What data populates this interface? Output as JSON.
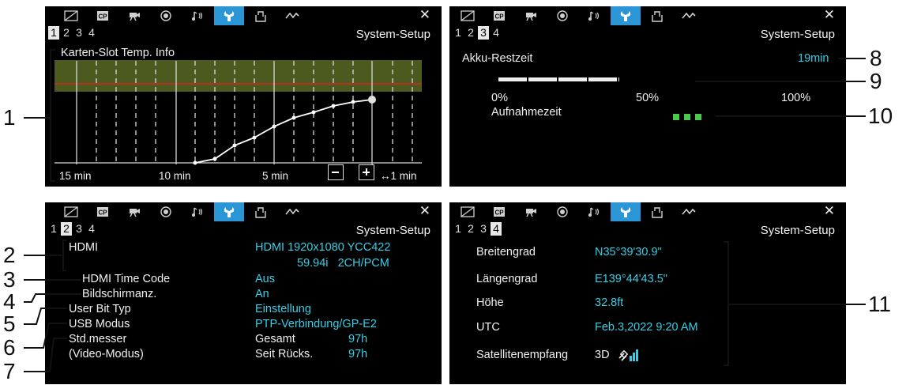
{
  "panel1": {
    "title": "System-Setup",
    "pages": [
      "1",
      "2",
      "3",
      "4"
    ],
    "active_page": 0,
    "chart_label": "Karten-Slot Temp. Info",
    "x_labels": [
      "15 min",
      "10 min",
      "5 min"
    ],
    "minus": "−",
    "plus": "+",
    "interval": "↔1 min"
  },
  "panel2": {
    "title": "System-Setup",
    "pages": [
      "1",
      "2",
      "3",
      "4"
    ],
    "active_page": 2,
    "battery_label": "Akku-Restzeit",
    "battery_value": "19min",
    "scale_0": "0%",
    "scale_50": "50%",
    "scale_100": "100%",
    "recording_label": "Aufnahmezeit",
    "battery_level": 0.42
  },
  "panel3": {
    "title": "System-Setup",
    "pages": [
      "1",
      "2",
      "3",
      "4"
    ],
    "active_page": 1,
    "hdmi_label": "HDMI",
    "hdmi_value_1": "HDMI 1920x1080 YCC422",
    "hdmi_value_2": "59.94i   2CH/PCM",
    "tc_label": "HDMI Time Code",
    "tc_value": "Aus",
    "disp_label": "Bildschirmanz.",
    "disp_value": "An",
    "ub_label": "User Bit Typ",
    "ub_value": "Einstellung",
    "usb_label": "USB Modus",
    "usb_value": "PTP-Verbindung/GP-E2",
    "hours_label_1": "Std.messer",
    "hours_label_2": "(Video-Modus)",
    "total_label": "Gesamt",
    "total_value": "97h",
    "reset_label": "Seit Rücks.",
    "reset_value": "97h"
  },
  "panel4": {
    "title": "System-Setup",
    "pages": [
      "1",
      "2",
      "3",
      "4"
    ],
    "active_page": 3,
    "lat_label": "Breitengrad",
    "lat_value": "N35°39'30.9\"",
    "lon_label": "Längengrad",
    "lon_value": "E139°44'43.5\"",
    "alt_label": "Höhe",
    "alt_value": "32.8ft",
    "utc_label": "UTC",
    "utc_value": "Feb.3,2022 9:20 AM",
    "sat_label": "Satellitenempfang",
    "sat_value": "3D"
  },
  "callouts": [
    "1",
    "2",
    "3",
    "4",
    "5",
    "6",
    "7",
    "8",
    "9",
    "10",
    "11"
  ],
  "colors": {
    "panel_bg": "#000000",
    "active_tab": "#2a96d6",
    "value_cyan": "#36cfe6",
    "temp_band": "#4d5a1f",
    "temp_limit": "#d0281e",
    "indicator_green": "#4cc94c"
  }
}
